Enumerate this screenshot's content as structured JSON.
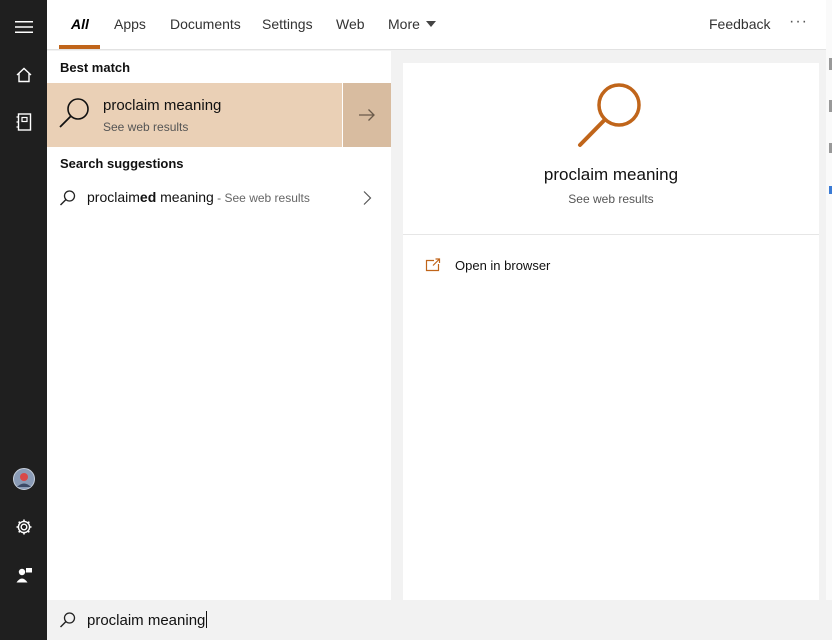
{
  "rail": {
    "icons": [
      "hamburger-menu-icon",
      "home-icon",
      "notebook-icon",
      "avatar",
      "gear-icon",
      "feedback-person-icon"
    ]
  },
  "tabs": {
    "items": [
      {
        "label": "All",
        "active": true
      },
      {
        "label": "Apps"
      },
      {
        "label": "Documents"
      },
      {
        "label": "Settings"
      },
      {
        "label": "Web"
      },
      {
        "label": "More"
      }
    ],
    "feedback": "Feedback",
    "more_options": "···"
  },
  "results": {
    "best_match_header": "Best match",
    "best_match": {
      "title": "proclaim meaning",
      "subtitle": "See web results"
    },
    "suggestions_header": "Search suggestions",
    "suggestion": {
      "prefix": "proclaim",
      "bold": "ed",
      "suffix": " meaning",
      "hint": " - See web results"
    }
  },
  "preview": {
    "title": "proclaim meaning",
    "subtitle": "See web results",
    "action_label": "Open in browser"
  },
  "search": {
    "query": "proclaim meaning"
  },
  "colors": {
    "accent": "#c0651a",
    "best_match_bg": "#ead0b6",
    "rail_bg": "#1f1f1f"
  }
}
